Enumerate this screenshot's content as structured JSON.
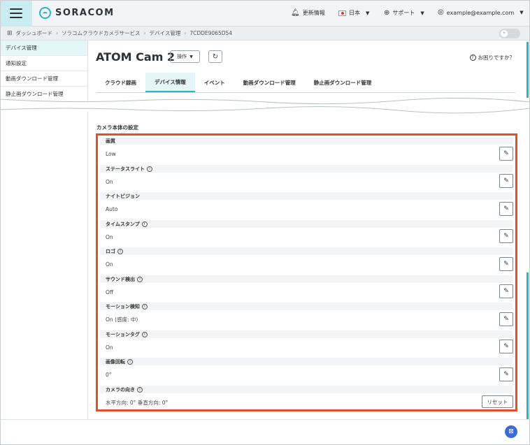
{
  "header": {
    "brand": "SORACOM",
    "updates": "更新情報",
    "language": "日本",
    "support": "サポート",
    "user": "example@example.com"
  },
  "breadcrumb": {
    "items": [
      "ダッシュボード",
      "ソラコムクラウドカメラサービス",
      "デバイス管理",
      "7CDDE9065D54"
    ]
  },
  "sidebar": {
    "items": [
      {
        "label": "デバイス管理",
        "active": true
      },
      {
        "label": "通知設定",
        "active": false
      },
      {
        "label": "動画ダウンロード管理",
        "active": false
      },
      {
        "label": "静止画ダウンロード管理",
        "active": false
      }
    ]
  },
  "device": {
    "title": "ATOM Cam 2",
    "ops_label": "操作",
    "help": "お困りですか？"
  },
  "tabs": [
    {
      "label": "クラウド録画",
      "active": false
    },
    {
      "label": "デバイス情報",
      "active": true
    },
    {
      "label": "イベント",
      "active": false
    },
    {
      "label": "動画ダウンロード管理",
      "active": false
    },
    {
      "label": "静止画ダウンロード管理",
      "active": false
    }
  ],
  "settings": {
    "section_title": "カメラ本体の設定",
    "reset_label": "リセット",
    "rows": [
      {
        "label": "画質",
        "value": "Low",
        "info": false
      },
      {
        "label": "ステータスライト",
        "value": "On",
        "info": true
      },
      {
        "label": "ナイトビジョン",
        "value": "Auto",
        "info": false
      },
      {
        "label": "タイムスタンプ",
        "value": "On",
        "info": true
      },
      {
        "label": "ロゴ",
        "value": "On",
        "info": true
      },
      {
        "label": "サウンド検出",
        "value": "Off",
        "info": true
      },
      {
        "label": "モーション検知",
        "value": "On (感度: 中)",
        "info": true
      },
      {
        "label": "モーションタグ",
        "value": "On",
        "info": true
      },
      {
        "label": "画像回転",
        "value": "0°",
        "info": true
      },
      {
        "label": "カメラの向き",
        "value": "水平方向: 0° 垂直方向: 0°",
        "info": true
      }
    ]
  },
  "colors": {
    "accent": "#26b6c7",
    "highlight_border": "#d9542b",
    "chat": "#3b6bd9"
  }
}
